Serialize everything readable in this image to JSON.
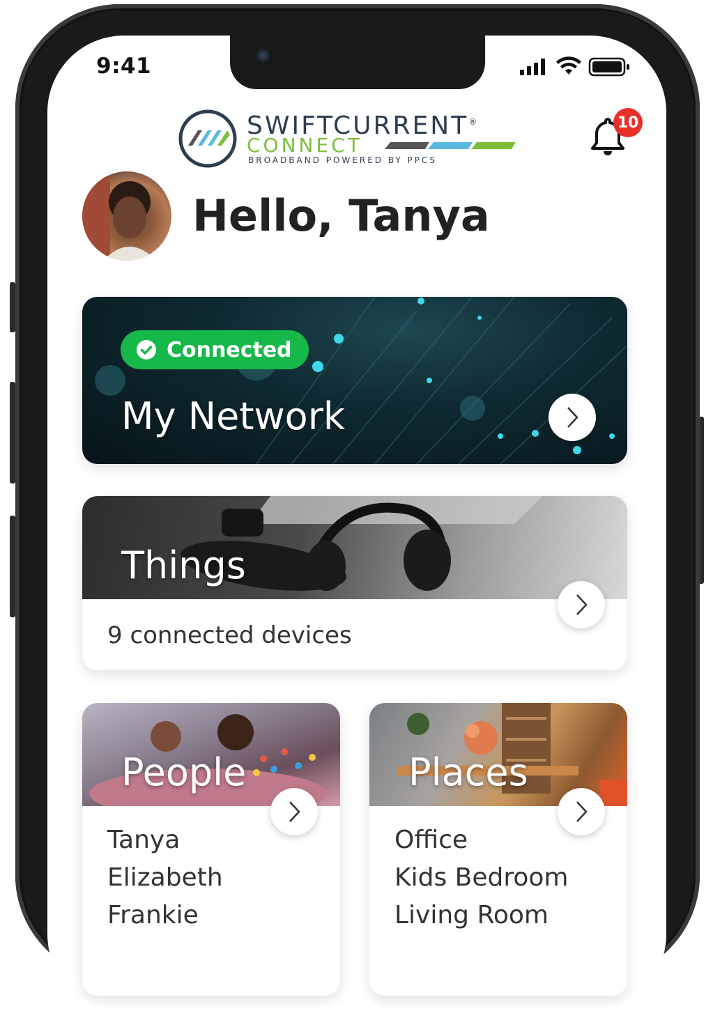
{
  "status_bar": {
    "time": "9:41"
  },
  "brand": {
    "name": "SWIFTCURRENT",
    "registered": "®",
    "subname": "CONNECT",
    "tagline": "BROADBAND POWERED BY PPCS",
    "colors": {
      "navy": "#2c3e50",
      "green": "#7dbf3b",
      "blue": "#5bb8e0",
      "gray": "#555555"
    }
  },
  "notifications": {
    "count": "10",
    "icon": "bell-icon",
    "badge_color": "#e8302a"
  },
  "user": {
    "greeting": "Hello, Tanya"
  },
  "network_card": {
    "status": "Connected",
    "status_color": "#16b84a",
    "title": "My Network"
  },
  "things_card": {
    "title": "Things",
    "subtitle": "9 connected devices"
  },
  "people_card": {
    "title": "People",
    "members": [
      "Tanya",
      "Elizabeth",
      "Frankie"
    ]
  },
  "places_card": {
    "title": "Places",
    "rooms": [
      "Office",
      "Kids Bedroom",
      "Living Room"
    ]
  }
}
